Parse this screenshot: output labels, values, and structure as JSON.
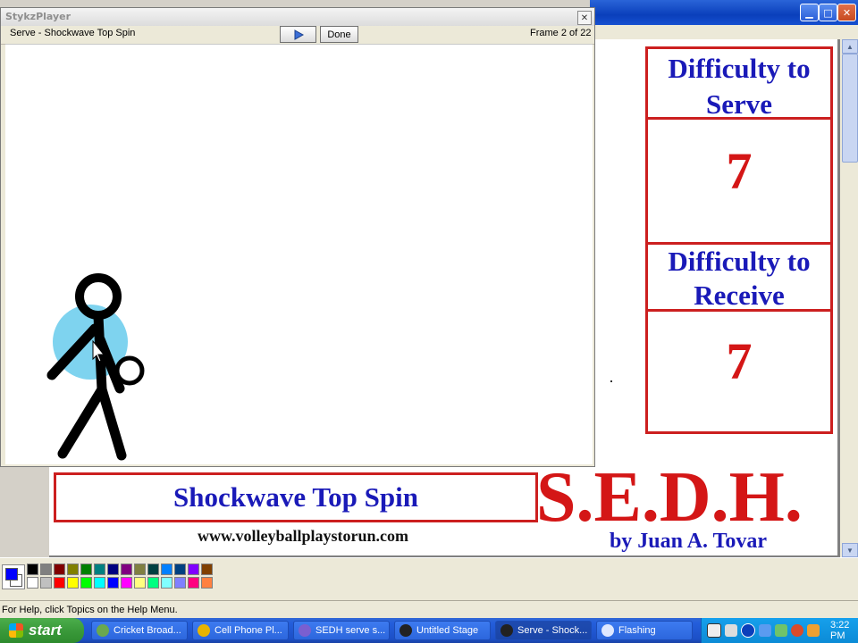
{
  "stykz": {
    "window_title": "StykzPlayer",
    "close_glyph": "✕",
    "animation_name": "Serve - Shockwave Top Spin",
    "done_label": "Done",
    "frame_counter": "Frame 2 of 22"
  },
  "paint_canvas": {
    "serve_heading": [
      "Difficulty to",
      "Serve"
    ],
    "serve_value": "7",
    "receive_heading": [
      "Difficulty to",
      "Receive"
    ],
    "receive_value": "7",
    "banner_title": "Shockwave Top Spin",
    "website": "www.volleyballplaystorun.com",
    "logo": "S.E.D.H.",
    "byline": "by Juan A. Tovar"
  },
  "paint_window": {
    "controls": [
      "minimize-icon",
      "maximize-icon",
      "close-icon"
    ],
    "status_text": "For Help, click Topics on the Help Menu.",
    "palette_top": [
      "#000000",
      "#808080",
      "#800000",
      "#808000",
      "#008000",
      "#008080",
      "#000080",
      "#800080",
      "#808040",
      "#004040",
      "#0080ff",
      "#004080",
      "#8000ff",
      "#804000"
    ],
    "palette_bottom": [
      "#ffffff",
      "#c0c0c0",
      "#ff0000",
      "#ffff00",
      "#00ff00",
      "#00ffff",
      "#0000ff",
      "#ff00ff",
      "#ffff80",
      "#00ff80",
      "#80ffff",
      "#8080ff",
      "#ff0080",
      "#ff8040"
    ],
    "foreground_color": "#0000ff",
    "background_color": "#ffffff"
  },
  "taskbar": {
    "start_label": "start",
    "tasks": [
      {
        "label": "Cricket Broad...",
        "icon": "paint-palette-icon",
        "color": "#6aa84f"
      },
      {
        "label": "Cell Phone Pl...",
        "icon": "chrome-icon",
        "color": "#e8b400"
      },
      {
        "label": "SEDH serve s...",
        "icon": "document-icon",
        "color": "#7a5fd0"
      },
      {
        "label": "Untitled Stage",
        "icon": "stykz-icon",
        "color": "#222222"
      },
      {
        "label": "Serve - Shock...",
        "icon": "stykz-icon",
        "color": "#222222"
      },
      {
        "label": "Flashing",
        "icon": "window-icon",
        "color": "#dfe8ff"
      }
    ],
    "clock": "3:22 PM"
  }
}
